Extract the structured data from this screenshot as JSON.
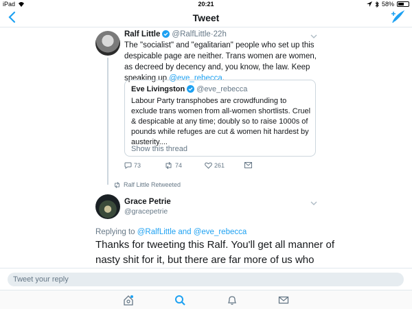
{
  "status_bar": {
    "device": "iPad",
    "time": "20:21",
    "battery_pct_text": "58%",
    "battery_level": 0.58
  },
  "nav": {
    "title": "Tweet"
  },
  "tweet1": {
    "name": "Ralf Little",
    "handle": "@RalfLittle",
    "time": "22h",
    "text_before": "The \"socialist\" and \"egalitarian\" people who set up this despicable page are neither. Trans women are women, as decreed by decency and, you know, the law. Keep speaking up ",
    "mention": "@eve_rebecca",
    "text_after": ".",
    "quote": {
      "name": "Eve Livingston",
      "handle": "@eve_rebecca",
      "text": "Labour Party transphobes are crowdfunding to exclude trans women from all-women shortlists. Cruel & despicable at any time; doubly so to raise 1000s of pounds while refuges are cut & women hit hardest by austerity....",
      "show_thread": "Show this thread"
    },
    "replies": "73",
    "retweets": "74",
    "likes": "261"
  },
  "retweet_notice": "Ralf Little Retweeted",
  "tweet2": {
    "name": "Grace Petrie",
    "handle": "@gracepetrie",
    "replying_prefix": "Replying to ",
    "replying_to_1": "@RalfLittle",
    "replying_and": " and ",
    "replying_to_2": "@eve_rebecca",
    "text": "Thanks for tweeting this Ralf. You'll get all manner of nasty shit for it, but there are far more of us who"
  },
  "reply_bar": {
    "placeholder": "Tweet your reply"
  },
  "colors": {
    "accent": "#1da1f2",
    "muted": "#657786",
    "border": "#e1e8ed"
  },
  "tabs": [
    "home-icon",
    "search-icon",
    "notifications-icon",
    "messages-icon"
  ]
}
